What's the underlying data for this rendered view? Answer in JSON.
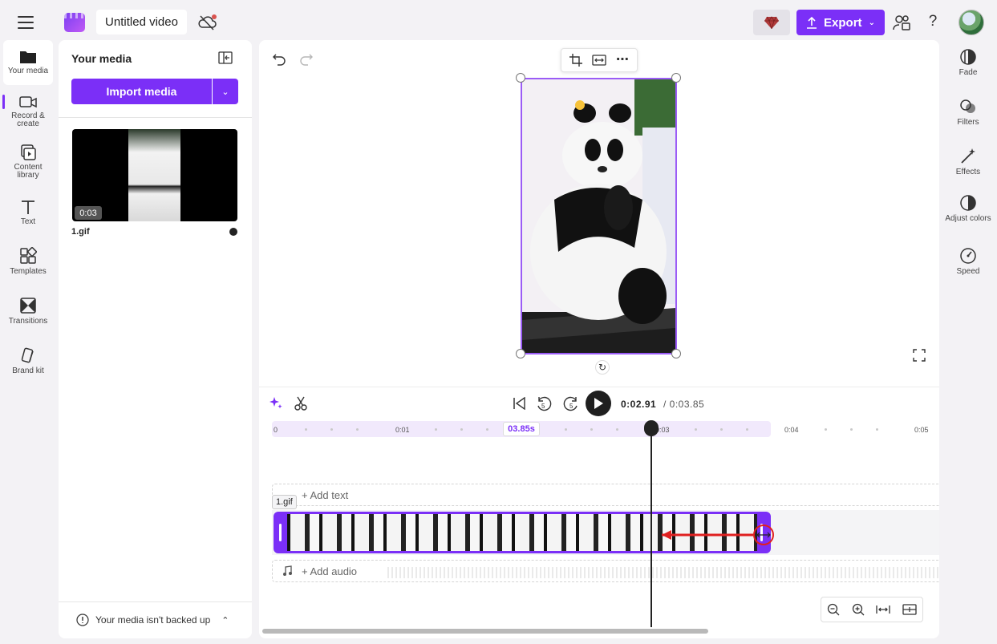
{
  "topbar": {
    "project_title": "Untitled video",
    "export_label": "Export",
    "help_label": "?"
  },
  "left_rail": {
    "items": [
      {
        "label": "Your media",
        "icon": "folder-icon"
      },
      {
        "label": "Record & create",
        "icon": "camera-icon"
      },
      {
        "label": "Content library",
        "icon": "content-library-icon"
      },
      {
        "label": "Text",
        "icon": "text-icon"
      },
      {
        "label": "Templates",
        "icon": "templates-icon"
      },
      {
        "label": "Transitions",
        "icon": "transitions-icon"
      },
      {
        "label": "Brand kit",
        "icon": "brand-kit-icon"
      }
    ]
  },
  "media_panel": {
    "title": "Your media",
    "import_label": "Import media",
    "asset": {
      "name": "1.gif",
      "duration": "0:03"
    },
    "backup_text": "Your media isn't backed up"
  },
  "player": {
    "current_time": "0:02.91",
    "total_time": "/ 0:03.85",
    "rewind_label": "5",
    "forward_label": "5"
  },
  "timeline": {
    "ticks": [
      "0",
      "0:01",
      "0:03",
      "0:04",
      "0:05"
    ],
    "clip_duration": "03.85s",
    "clip_label": "1.gif",
    "add_text_label": "+ Add text",
    "add_audio_label": "+ Add audio"
  },
  "right_rail": {
    "items": [
      {
        "label": "Fade",
        "icon": "fade-icon"
      },
      {
        "label": "Filters",
        "icon": "filters-icon"
      },
      {
        "label": "Effects",
        "icon": "effects-icon"
      },
      {
        "label": "Adjust colors",
        "icon": "adjust-colors-icon"
      },
      {
        "label": "Speed",
        "icon": "speed-icon"
      }
    ]
  },
  "colors": {
    "accent": "#7b2ff7",
    "annotation": "#e02020"
  }
}
